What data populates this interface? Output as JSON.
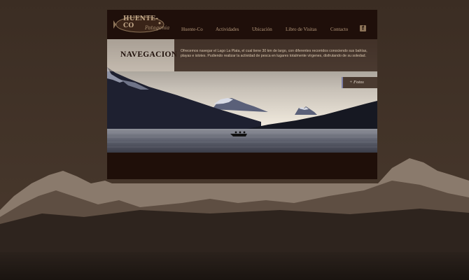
{
  "site": {
    "logo_name": "HUENTE-CO",
    "logo_sub": "Patagonia"
  },
  "nav": {
    "items": [
      {
        "label": "Huente-Co"
      },
      {
        "label": "Actividades"
      },
      {
        "label": "Ubicación"
      },
      {
        "label": "Libro de Visitas"
      },
      {
        "label": "Contacto"
      }
    ],
    "facebook_icon": "facebook-icon"
  },
  "section": {
    "title": "NAVEGACION",
    "description": "Ofrecemos navegar el Lago La Plata, el cual tiene 30 km de largo, con diferentes recorridos conociendo sus bahías, playas e islotes. Pudiendo realizar la actividad de pesca en lugares totalmente vírgenes, disfrutando de su soledad.",
    "photos_button": "+ Fotos"
  },
  "colors": {
    "page_bg": "#1f0f09",
    "nav_text": "#b79a7c",
    "background": "#3a2c22"
  }
}
